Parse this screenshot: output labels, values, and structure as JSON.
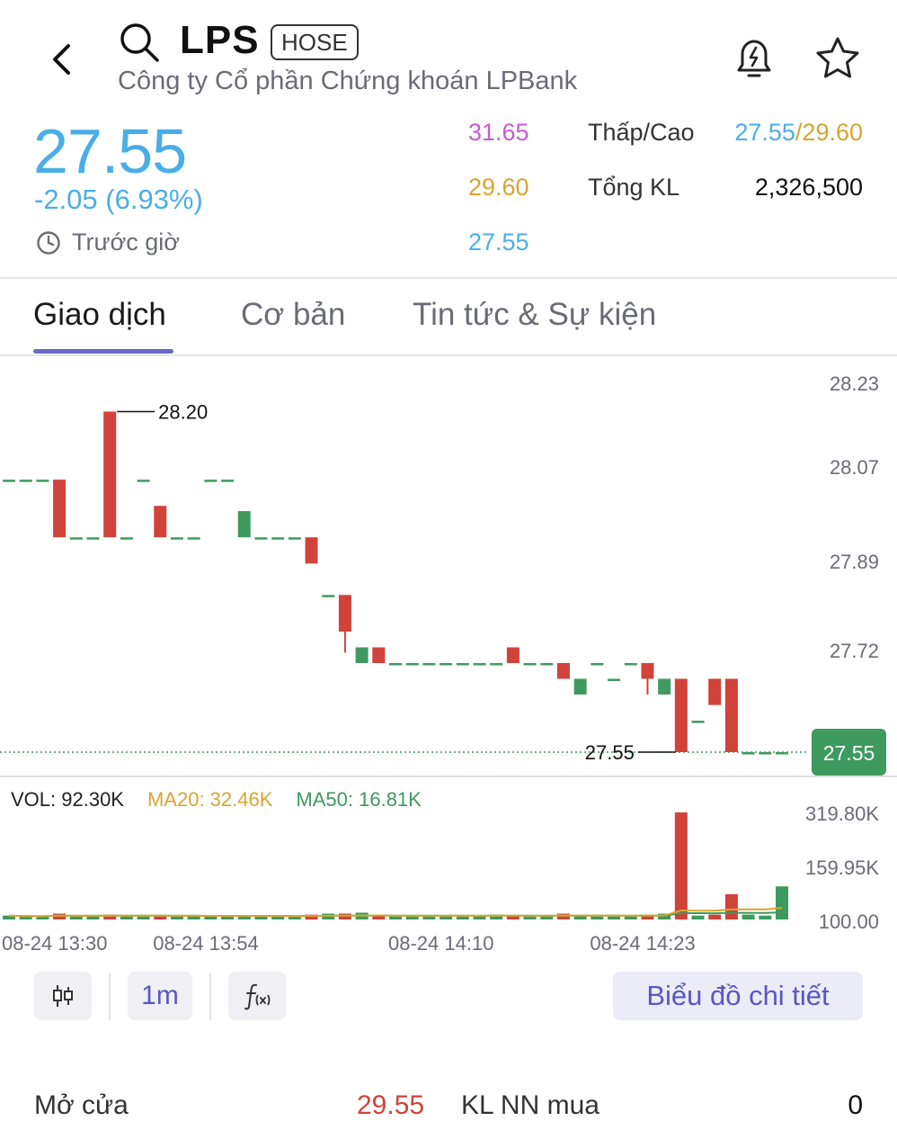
{
  "header": {
    "ticker": "LPS",
    "exchange": "HOSE",
    "company_name": "Công ty Cổ phần Chứng khoán LPBank"
  },
  "quote": {
    "price": "27.55",
    "change": "-2.05 (6.93%)",
    "session_label": "Trước giờ",
    "ceiling": "31.65",
    "reference": "29.60",
    "floor": "27.55",
    "low_high_label": "Thấp/Cao",
    "low": "27.55",
    "high_sep": "/",
    "high": "29.60",
    "total_volume_label": "Tổng KL",
    "total_volume": "2,326,500"
  },
  "tabs": [
    {
      "label": "Giao dịch",
      "active": true
    },
    {
      "label": "Cơ bản",
      "active": false
    },
    {
      "label": "Tin tức & Sự kiện",
      "active": false
    }
  ],
  "volume_legend": {
    "vol": "VOL: 92.30K",
    "ma20": "MA20: 32.46K",
    "ma50": "MA50: 16.81K"
  },
  "toolbar": {
    "interval": "1m",
    "detail_label": "Biểu đồ chi tiết"
  },
  "bottom": {
    "open_label": "Mở cửa",
    "open_value": "29.55",
    "foreign_buy_label": "KL NN mua",
    "foreign_buy_value": "0"
  },
  "colors": {
    "up": "#3e9a5e",
    "down": "#d1423a",
    "price": "#4aaee6",
    "ceiling": "#c85ad8",
    "reference": "#d9a530",
    "accent": "#5a57c4"
  },
  "chart_data": {
    "type": "candlestick",
    "price_axis": {
      "ticks": [
        "28.23",
        "28.07",
        "27.89",
        "27.72",
        "27.55"
      ],
      "range": [
        27.55,
        28.23
      ]
    },
    "volume_axis": {
      "ticks": [
        "319.80K",
        "159.95K",
        "100.00"
      ]
    },
    "x_ticks": [
      "08-24 13:30",
      "08-24 13:54",
      "08-24 14:10",
      "08-24 14:23"
    ],
    "annotations": {
      "high": "28.20",
      "low": "27.55"
    },
    "last_price_label": "27.55",
    "candles": [
      {
        "o": 28.07,
        "c": 28.07,
        "h": 28.07,
        "l": 28.07,
        "v": 4
      },
      {
        "o": 28.07,
        "c": 28.07,
        "h": 28.07,
        "l": 28.07,
        "v": 3
      },
      {
        "o": 28.07,
        "c": 28.07,
        "h": 28.07,
        "l": 28.07,
        "v": 3
      },
      {
        "o": 28.07,
        "c": 27.96,
        "h": 28.07,
        "l": 27.96,
        "v": 6
      },
      {
        "o": 27.96,
        "c": 27.96,
        "h": 27.96,
        "l": 27.96,
        "v": 3
      },
      {
        "o": 27.96,
        "c": 27.96,
        "h": 27.96,
        "l": 27.96,
        "v": 4
      },
      {
        "o": 28.2,
        "c": 27.96,
        "h": 28.2,
        "l": 27.96,
        "v": 5
      },
      {
        "o": 27.96,
        "c": 27.96,
        "h": 27.96,
        "l": 27.96,
        "v": 4
      },
      {
        "o": 28.07,
        "c": 28.07,
        "h": 28.07,
        "l": 28.07,
        "v": 3
      },
      {
        "o": 28.02,
        "c": 27.96,
        "h": 28.02,
        "l": 27.96,
        "v": 4
      },
      {
        "o": 27.96,
        "c": 27.96,
        "h": 27.96,
        "l": 27.96,
        "v": 3
      },
      {
        "o": 27.96,
        "c": 27.96,
        "h": 27.96,
        "l": 27.96,
        "v": 3
      },
      {
        "o": 28.07,
        "c": 28.07,
        "h": 28.07,
        "l": 28.07,
        "v": 3
      },
      {
        "o": 28.07,
        "c": 28.07,
        "h": 28.07,
        "l": 28.07,
        "v": 3
      },
      {
        "o": 27.96,
        "c": 28.01,
        "h": 28.01,
        "l": 27.96,
        "v": 4
      },
      {
        "o": 27.96,
        "c": 27.96,
        "h": 27.96,
        "l": 27.96,
        "v": 3
      },
      {
        "o": 27.96,
        "c": 27.96,
        "h": 27.96,
        "l": 27.96,
        "v": 3
      },
      {
        "o": 27.96,
        "c": 27.96,
        "h": 27.96,
        "l": 27.96,
        "v": 3
      },
      {
        "o": 27.96,
        "c": 27.91,
        "h": 27.96,
        "l": 27.91,
        "v": 5
      },
      {
        "o": 27.85,
        "c": 27.85,
        "h": 27.85,
        "l": 27.85,
        "v": 6
      },
      {
        "o": 27.85,
        "c": 27.78,
        "h": 27.85,
        "l": 27.74,
        "v": 6
      },
      {
        "o": 27.72,
        "c": 27.75,
        "h": 27.75,
        "l": 27.72,
        "v": 7
      },
      {
        "o": 27.75,
        "c": 27.72,
        "h": 27.75,
        "l": 27.72,
        "v": 5
      },
      {
        "o": 27.72,
        "c": 27.72,
        "h": 27.72,
        "l": 27.72,
        "v": 3
      },
      {
        "o": 27.72,
        "c": 27.72,
        "h": 27.72,
        "l": 27.72,
        "v": 3
      },
      {
        "o": 27.72,
        "c": 27.72,
        "h": 27.72,
        "l": 27.72,
        "v": 3
      },
      {
        "o": 27.72,
        "c": 27.72,
        "h": 27.72,
        "l": 27.72,
        "v": 3
      },
      {
        "o": 27.72,
        "c": 27.72,
        "h": 27.72,
        "l": 27.72,
        "v": 3
      },
      {
        "o": 27.72,
        "c": 27.72,
        "h": 27.72,
        "l": 27.72,
        "v": 3
      },
      {
        "o": 27.72,
        "c": 27.72,
        "h": 27.72,
        "l": 27.72,
        "v": 5
      },
      {
        "o": 27.75,
        "c": 27.72,
        "h": 27.75,
        "l": 27.72,
        "v": 4
      },
      {
        "o": 27.72,
        "c": 27.72,
        "h": 27.72,
        "l": 27.72,
        "v": 3
      },
      {
        "o": 27.72,
        "c": 27.72,
        "h": 27.72,
        "l": 27.72,
        "v": 3
      },
      {
        "o": 27.72,
        "c": 27.69,
        "h": 27.72,
        "l": 27.69,
        "v": 6
      },
      {
        "o": 27.66,
        "c": 27.69,
        "h": 27.69,
        "l": 27.66,
        "v": 4
      },
      {
        "o": 27.72,
        "c": 27.72,
        "h": 27.72,
        "l": 27.72,
        "v": 3
      },
      {
        "o": 27.69,
        "c": 27.69,
        "h": 27.69,
        "l": 27.69,
        "v": 3
      },
      {
        "o": 27.72,
        "c": 27.72,
        "h": 27.72,
        "l": 27.72,
        "v": 3
      },
      {
        "o": 27.72,
        "c": 27.69,
        "h": 27.72,
        "l": 27.66,
        "v": 5
      },
      {
        "o": 27.66,
        "c": 27.69,
        "h": 27.69,
        "l": 27.66,
        "v": 6
      },
      {
        "o": 27.69,
        "c": 27.55,
        "h": 27.69,
        "l": 27.55,
        "v": 110
      },
      {
        "o": 27.61,
        "c": 27.61,
        "h": 27.61,
        "l": 27.61,
        "v": 4
      },
      {
        "o": 27.69,
        "c": 27.64,
        "h": 27.69,
        "l": 27.64,
        "v": 5
      },
      {
        "o": 27.69,
        "c": 27.55,
        "h": 27.69,
        "l": 27.55,
        "v": 26
      },
      {
        "o": 27.55,
        "c": 27.55,
        "h": 27.55,
        "l": 27.55,
        "v": 5
      },
      {
        "o": 27.55,
        "c": 27.55,
        "h": 27.55,
        "l": 27.55,
        "v": 4
      },
      {
        "o": 27.55,
        "c": 27.55,
        "h": 27.55,
        "l": 27.55,
        "v": 34
      }
    ]
  }
}
